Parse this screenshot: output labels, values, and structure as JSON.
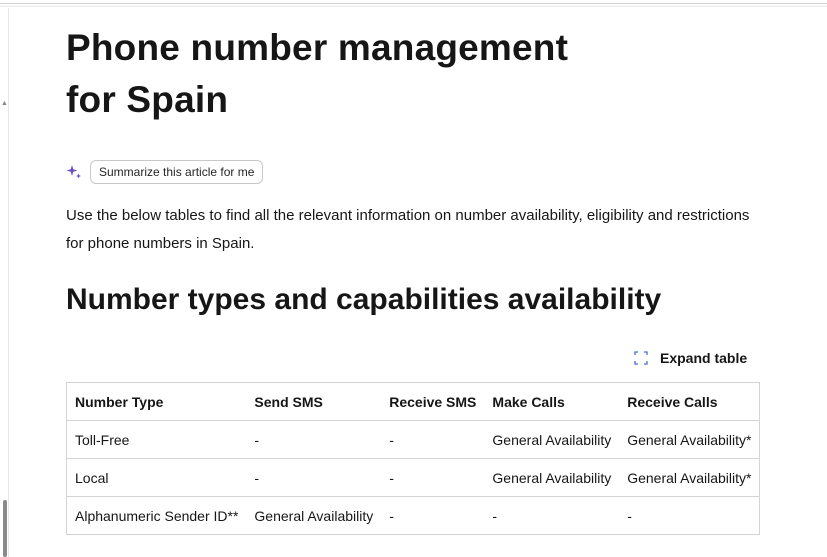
{
  "page": {
    "title_line1": "Phone number management",
    "title_line2": "for Spain"
  },
  "summarize": {
    "icon": "sparkle-icon",
    "label": "Summarize this article for me"
  },
  "intro_text": "Use the below tables to find all the relevant information on number availability, eligibility and restrictions for phone numbers in Spain.",
  "section_heading": "Number types and capabilities availability",
  "expand": {
    "icon": "expand-icon",
    "label": "Expand table"
  },
  "table": {
    "headers": [
      "Number Type",
      "Send SMS",
      "Receive SMS",
      "Make Calls",
      "Receive Calls"
    ],
    "rows": [
      [
        "Toll-Free",
        "-",
        "-",
        "General Availability",
        "General Availability*"
      ],
      [
        "Local",
        "-",
        "-",
        "General Availability",
        "General Availability*"
      ],
      [
        "Alphanumeric Sender ID**",
        "General Availability",
        "-",
        "-",
        "-"
      ]
    ]
  },
  "colors": {
    "accent_sparkle": "#6b4ec2",
    "text": "#161616",
    "border": "#d4d4d4"
  }
}
